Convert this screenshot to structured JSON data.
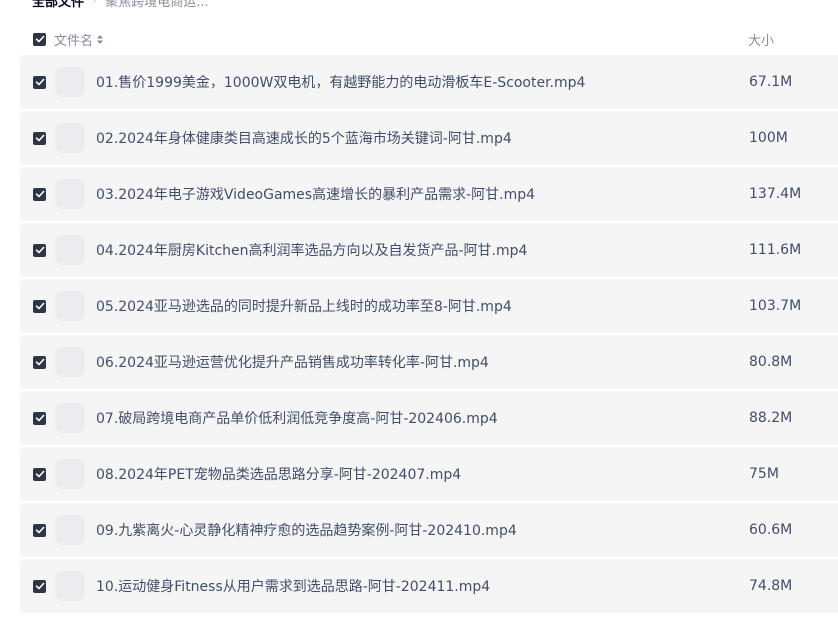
{
  "breadcrumb": {
    "root": "全部文件",
    "separator": "›",
    "current": "聚焦跨境电商运..."
  },
  "header": {
    "name_label": "文件名",
    "size_label": "大小",
    "select_all_checked": true
  },
  "files": [
    {
      "name": "01.售价1999美金，1000W双电机，有越野能力的电动滑板车E-Scooter.mp4",
      "size": "67.1M",
      "checked": true
    },
    {
      "name": "02.2024年身体健康类目高速成长的5个蓝海市场关键词-阿甘.mp4",
      "size": "100M",
      "checked": true
    },
    {
      "name": "03.2024年电子游戏VideoGames高速增长的暴利产品需求-阿甘.mp4",
      "size": "137.4M",
      "checked": true
    },
    {
      "name": "04.2024年厨房Kitchen高利润率选品方向以及自发货产品-阿甘.mp4",
      "size": "111.6M",
      "checked": true
    },
    {
      "name": "05.2024亚马逊选品的同时提升新品上线时的成功率至8-阿甘.mp4",
      "size": "103.7M",
      "checked": true
    },
    {
      "name": "06.2024亚马逊运营优化提升产品销售成功率转化率-阿甘.mp4",
      "size": "80.8M",
      "checked": true
    },
    {
      "name": "07.破局跨境电商产品单价低利润低竞争度高-阿甘-202406.mp4",
      "size": "88.2M",
      "checked": true
    },
    {
      "name": "08.2024年PET宠物品类选品思路分享-阿甘-202407.mp4",
      "size": "75M",
      "checked": true
    },
    {
      "name": "09.九紫离火-心灵静化精神疗愈的选品趋势案例-阿甘-202410.mp4",
      "size": "60.6M",
      "checked": true
    },
    {
      "name": "10.运动健身Fitness从用户需求到选品思路-阿甘-202411.mp4",
      "size": "74.8M",
      "checked": true
    }
  ],
  "colors": {
    "row_background": "#f5f5f6",
    "checkbox": "#2e3646",
    "text": "#424e67",
    "muted_text": "#878c9c"
  }
}
